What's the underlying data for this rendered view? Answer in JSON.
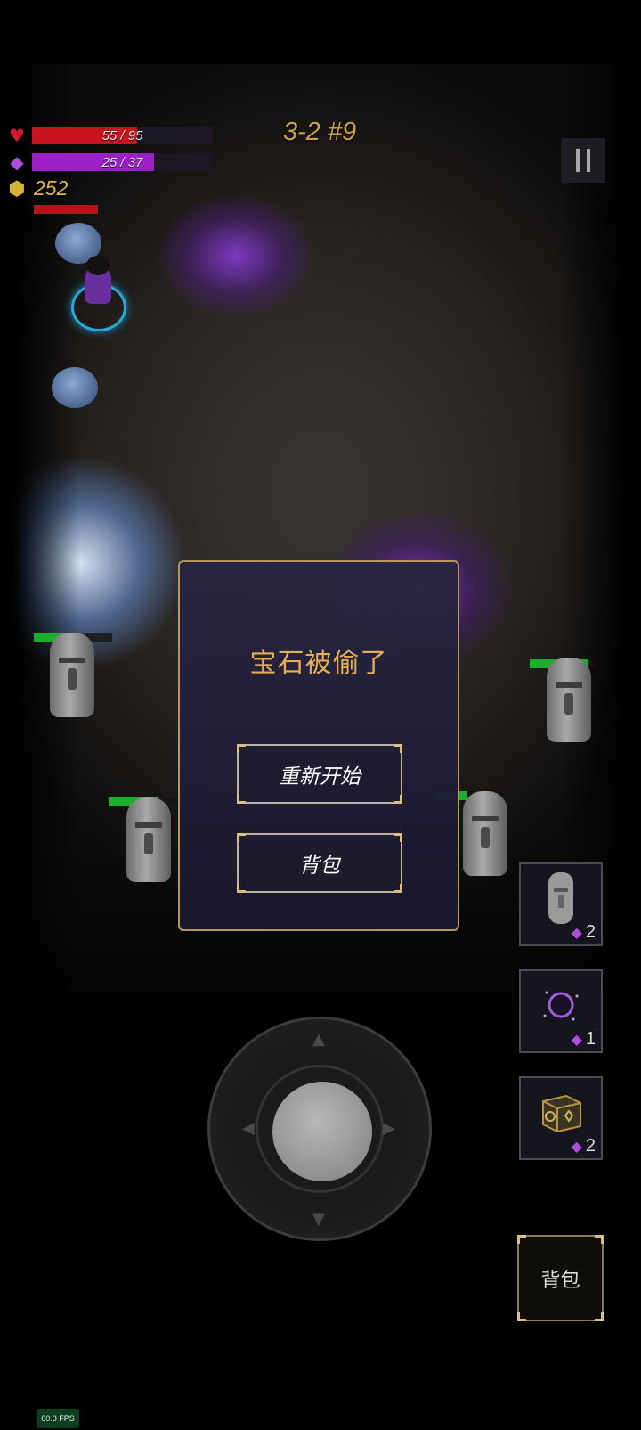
{
  "hud": {
    "hp": {
      "text": "55 / 95",
      "current": 55,
      "max": 95,
      "color": "#c8141e"
    },
    "mana": {
      "text": "25 / 37",
      "current": 25,
      "max": 37,
      "color": "#9b20c6"
    },
    "gold": "252",
    "stage": "3-2 #9",
    "icons": {
      "hp": "heart-icon",
      "mana": "gem-icon",
      "gold": "coin-icon",
      "pause": "pause-icon"
    }
  },
  "dialog": {
    "title": "宝石被偷了",
    "restart_label": "重新开始",
    "backpack_label": "背包"
  },
  "skills": [
    {
      "icon": "statue-icon",
      "count": "2"
    },
    {
      "icon": "vortex-icon",
      "count": "1"
    },
    {
      "icon": "crate-icon",
      "count": "2"
    }
  ],
  "backpack_button": "背包",
  "fps": "60.0 FPS",
  "colors": {
    "accent": "#e6ad55",
    "dialog_border": "#b6965a",
    "gold": "#e0b450"
  }
}
